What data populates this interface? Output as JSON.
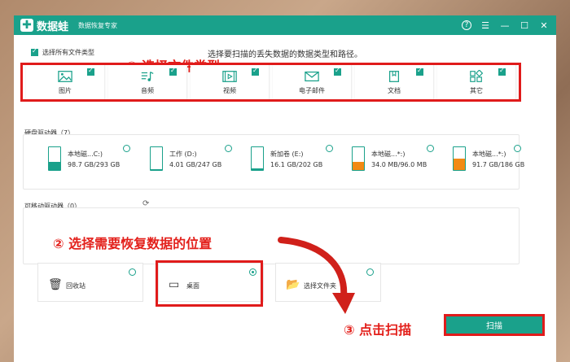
{
  "app": {
    "name": "数据蛙",
    "subtitle": "数据恢复专家",
    "logo_mark": "✚"
  },
  "window_controls": [
    "help-icon",
    "menu-icon",
    "minimize-icon",
    "maximize-icon",
    "close-icon"
  ],
  "prompt": "选择要扫描的丢失数据的数据类型和路径。",
  "select_all": {
    "label": "选择所有文件类型",
    "checked": true
  },
  "annotations": {
    "step1": "① 选择文件类型",
    "step2": "② 选择需要恢复数据的位置",
    "step3": "③ 点击扫描"
  },
  "file_types": [
    {
      "label": "图片",
      "icon": "image-icon",
      "checked": true
    },
    {
      "label": "音频",
      "icon": "music-icon",
      "checked": true
    },
    {
      "label": "视频",
      "icon": "video-icon",
      "checked": true
    },
    {
      "label": "电子邮件",
      "icon": "mail-icon",
      "checked": true
    },
    {
      "label": "文档",
      "icon": "document-icon",
      "checked": true
    },
    {
      "label": "其它",
      "icon": "apps-icon",
      "checked": true
    }
  ],
  "hard_drives": {
    "title": "硬盘驱动器（7）",
    "items": [
      {
        "name": "本地磁...C:)",
        "size": "98.7 GB/293 GB",
        "fill": 0.34,
        "color": "#1aa18b"
      },
      {
        "name": "工作 (D:)",
        "size": "4.01 GB/247 GB",
        "fill": 0.02,
        "color": "#1aa18b"
      },
      {
        "name": "新加卷 (E:)",
        "size": "16.1 GB/202 GB",
        "fill": 0.08,
        "color": "#1aa18b"
      },
      {
        "name": "本地磁...*:)",
        "size": "34.0 MB/96.0 MB",
        "fill": 0.35,
        "color": "#f28a14"
      },
      {
        "name": "本地磁...*:)",
        "size": "91.7 GB/186 GB",
        "fill": 0.49,
        "color": "#f28a14"
      }
    ]
  },
  "removable": {
    "title": "可移动驱动器（0）"
  },
  "locations": [
    {
      "label": "回收站",
      "icon": "recycle-bin-icon",
      "selected": false
    },
    {
      "label": "桌面",
      "icon": "desktop-icon",
      "selected": true
    },
    {
      "label": "选择文件夹",
      "icon": "folder-icon",
      "selected": false
    }
  ],
  "scan_button": "扫描",
  "colors": {
    "accent": "#1aa18b",
    "highlight": "#e01b1b",
    "warning": "#f28a14"
  }
}
